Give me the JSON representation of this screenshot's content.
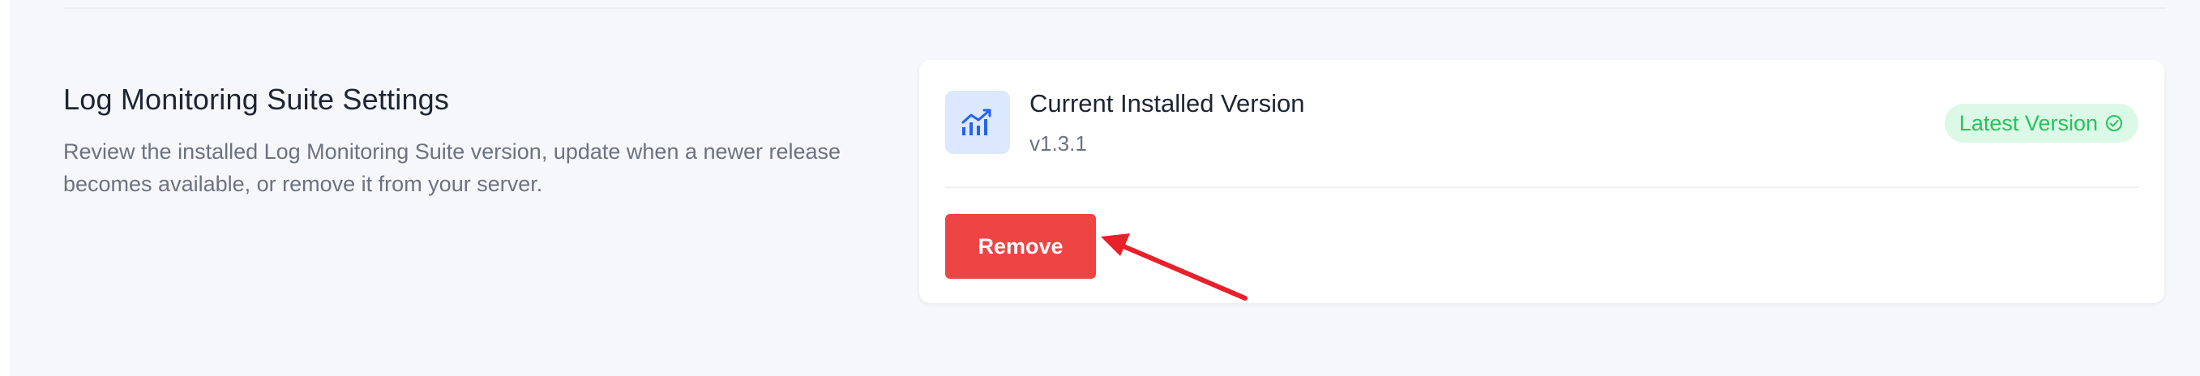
{
  "section": {
    "title": "Log Monitoring Suite Settings",
    "description": "Review the installed Log Monitoring Suite version, update when a newer release becomes available, or remove it from your server."
  },
  "card": {
    "icon": "chart-icon",
    "version_title": "Current Installed Version",
    "version_value": "v1.3.1",
    "badge_label": "Latest Version",
    "badge_icon": "check-circle-icon",
    "remove_label": "Remove"
  },
  "colors": {
    "danger": "#ef4444",
    "success": "#22c55e",
    "success_bg": "#dcf8e6",
    "icon_bg": "#dbe8fd",
    "icon_fg": "#2563eb",
    "annotation_arrow": "#e8202a"
  }
}
